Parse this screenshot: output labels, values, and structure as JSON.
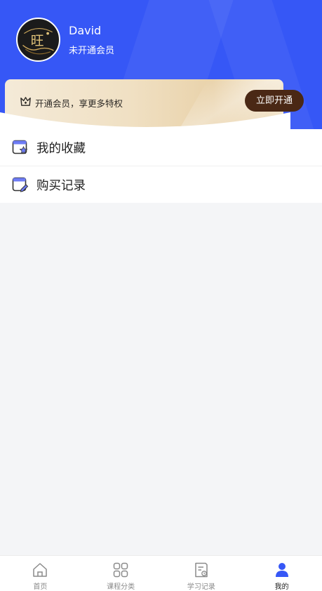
{
  "user": {
    "name": "David",
    "member_status": "未开通会员",
    "avatar_icon": "avatar-logo"
  },
  "vip_banner": {
    "text": "开通会员，享更多特权",
    "button_label": "立即开通",
    "icon": "crown-icon"
  },
  "menu": {
    "items": [
      {
        "label": "我的收藏",
        "icon": "favorite-icon"
      },
      {
        "label": "购买记录",
        "icon": "purchase-record-icon"
      }
    ]
  },
  "tabbar": {
    "items": [
      {
        "label": "首页",
        "icon": "home-icon",
        "active": false
      },
      {
        "label": "课程分类",
        "icon": "category-icon",
        "active": false
      },
      {
        "label": "学习记录",
        "icon": "study-record-icon",
        "active": false
      },
      {
        "label": "我的",
        "icon": "profile-icon",
        "active": true
      }
    ]
  },
  "colors": {
    "header_bg": "#3657f6",
    "vip_button_bg": "#4a2815",
    "active_tab": "#3657f6",
    "page_bg": "#f4f5f7"
  }
}
